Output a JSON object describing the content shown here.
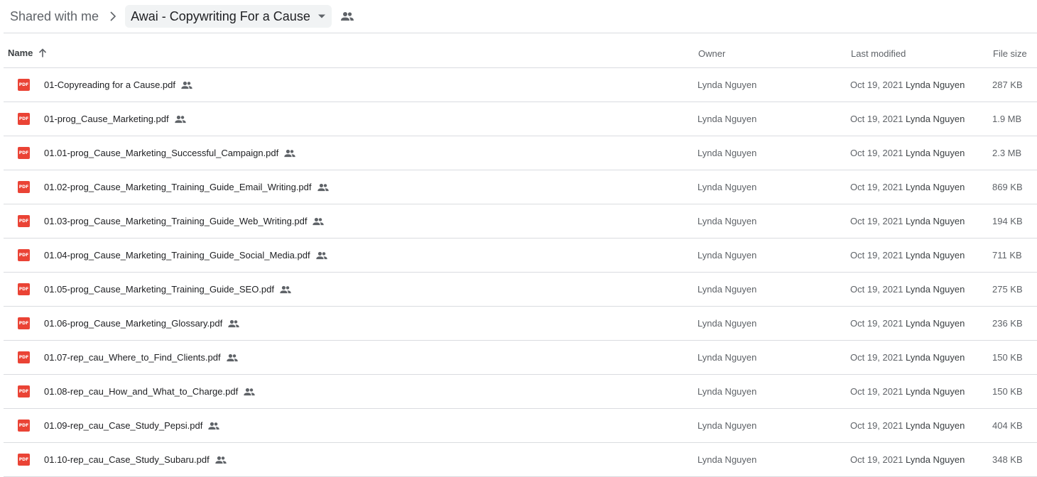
{
  "breadcrumb": {
    "root": "Shared with me",
    "current": "Awai - Copywriting For a Cause"
  },
  "icons": {
    "chevron": "chevron-right-icon",
    "dropdown": "arrow-drop-down-icon",
    "shared": "people-icon",
    "sort": "arrow-upward-icon",
    "file": "pdf-icon"
  },
  "columns": {
    "name": "Name",
    "owner": "Owner",
    "modified": "Last modified",
    "size": "File size"
  },
  "files": [
    {
      "name": "01-Copyreading for a Cause.pdf",
      "owner": "Lynda Nguyen",
      "date": "Oct 19, 2021",
      "by": "Lynda Nguyen",
      "size": "287 KB"
    },
    {
      "name": "01-prog_Cause_Marketing.pdf",
      "owner": "Lynda Nguyen",
      "date": "Oct 19, 2021",
      "by": "Lynda Nguyen",
      "size": "1.9 MB"
    },
    {
      "name": "01.01-prog_Cause_Marketing_Successful_Campaign.pdf",
      "owner": "Lynda Nguyen",
      "date": "Oct 19, 2021",
      "by": "Lynda Nguyen",
      "size": "2.3 MB"
    },
    {
      "name": "01.02-prog_Cause_Marketing_Training_Guide_Email_Writing.pdf",
      "owner": "Lynda Nguyen",
      "date": "Oct 19, 2021",
      "by": "Lynda Nguyen",
      "size": "869 KB"
    },
    {
      "name": "01.03-prog_Cause_Marketing_Training_Guide_Web_Writing.pdf",
      "owner": "Lynda Nguyen",
      "date": "Oct 19, 2021",
      "by": "Lynda Nguyen",
      "size": "194 KB"
    },
    {
      "name": "01.04-prog_Cause_Marketing_Training_Guide_Social_Media.pdf",
      "owner": "Lynda Nguyen",
      "date": "Oct 19, 2021",
      "by": "Lynda Nguyen",
      "size": "711 KB"
    },
    {
      "name": "01.05-prog_Cause_Marketing_Training_Guide_SEO.pdf",
      "owner": "Lynda Nguyen",
      "date": "Oct 19, 2021",
      "by": "Lynda Nguyen",
      "size": "275 KB"
    },
    {
      "name": "01.06-prog_Cause_Marketing_Glossary.pdf",
      "owner": "Lynda Nguyen",
      "date": "Oct 19, 2021",
      "by": "Lynda Nguyen",
      "size": "236 KB"
    },
    {
      "name": "01.07-rep_cau_Where_to_Find_Clients.pdf",
      "owner": "Lynda Nguyen",
      "date": "Oct 19, 2021",
      "by": "Lynda Nguyen",
      "size": "150 KB"
    },
    {
      "name": "01.08-rep_cau_How_and_What_to_Charge.pdf",
      "owner": "Lynda Nguyen",
      "date": "Oct 19, 2021",
      "by": "Lynda Nguyen",
      "size": "150 KB"
    },
    {
      "name": "01.09-rep_cau_Case_Study_Pepsi.pdf",
      "owner": "Lynda Nguyen",
      "date": "Oct 19, 2021",
      "by": "Lynda Nguyen",
      "size": "404 KB"
    },
    {
      "name": "01.10-rep_cau_Case_Study_Subaru.pdf",
      "owner": "Lynda Nguyen",
      "date": "Oct 19, 2021",
      "by": "Lynda Nguyen",
      "size": "348 KB"
    }
  ],
  "pdf_badge": "PDF",
  "colors": {
    "pdf_red": "#ea4335",
    "divider": "#dadce0",
    "secondary_text": "#5f6368",
    "crumb_bg": "#f1f3f4"
  }
}
